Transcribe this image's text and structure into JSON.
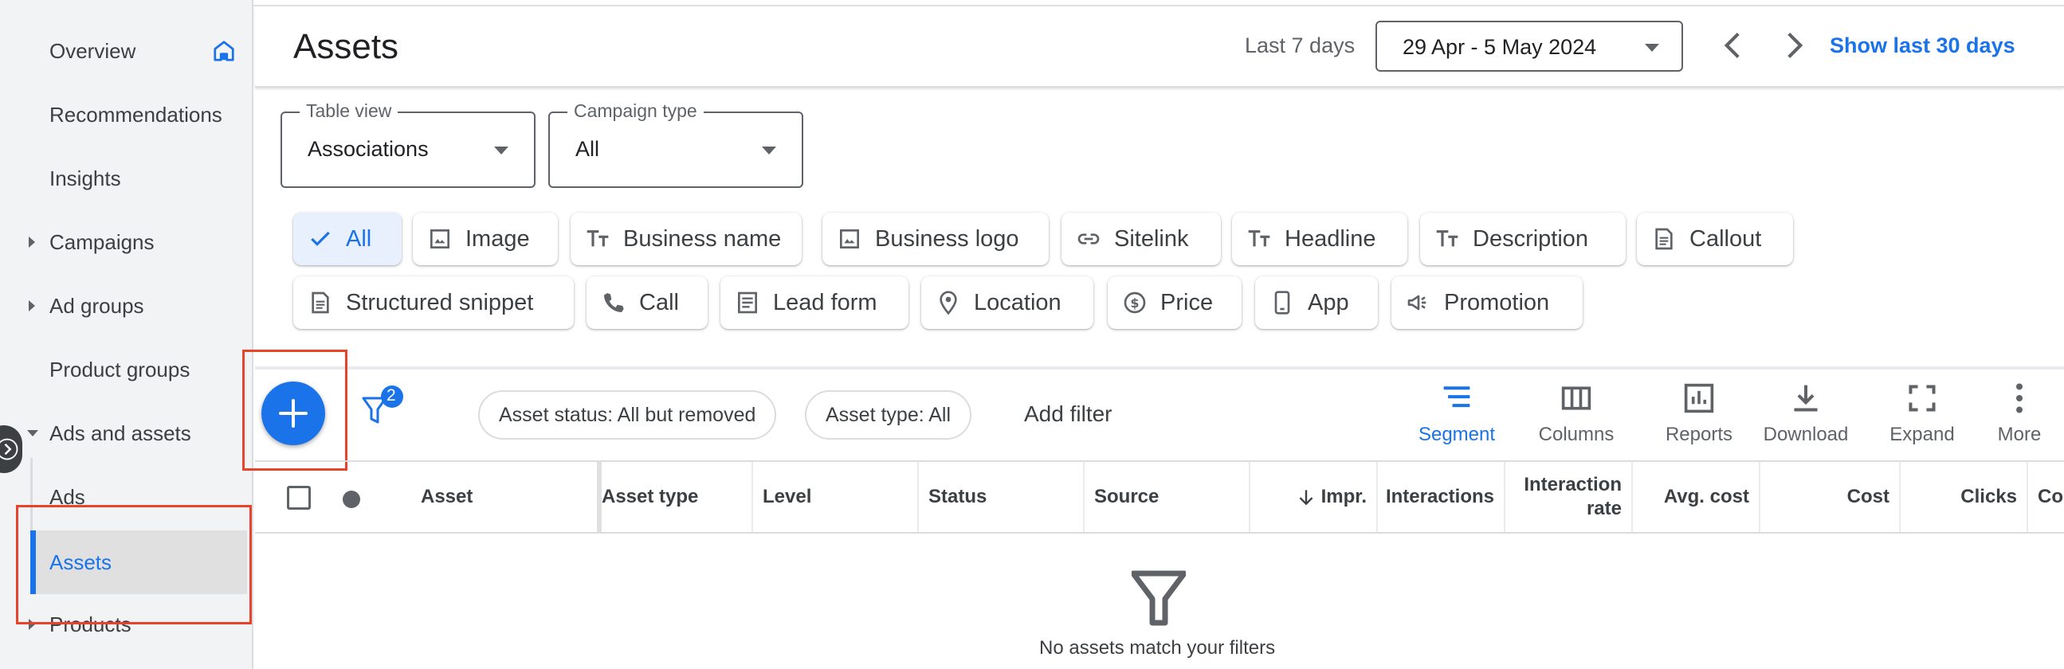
{
  "sidebar": {
    "items": [
      {
        "label": "Overview"
      },
      {
        "label": "Recommendations"
      },
      {
        "label": "Insights"
      },
      {
        "label": "Campaigns"
      },
      {
        "label": "Ad groups"
      },
      {
        "label": "Product groups"
      },
      {
        "label": "Ads and assets"
      },
      {
        "label": "Ads"
      },
      {
        "label": "Assets"
      },
      {
        "label": "Products"
      }
    ]
  },
  "header": {
    "title": "Assets",
    "date_label": "Last 7 days",
    "date_range": "29 Apr - 5 May 2024",
    "show_last_30": "Show last 30 days"
  },
  "filters": {
    "table_view": {
      "label": "Table view",
      "value": "Associations"
    },
    "campaign_type": {
      "label": "Campaign type",
      "value": "All"
    }
  },
  "chips": [
    {
      "label": "All",
      "icon": "check-icon",
      "selected": true
    },
    {
      "label": "Image",
      "icon": "image-icon"
    },
    {
      "label": "Business name",
      "icon": "text-icon"
    },
    {
      "label": "Business logo",
      "icon": "image-icon"
    },
    {
      "label": "Sitelink",
      "icon": "link-icon"
    },
    {
      "label": "Headline",
      "icon": "text-icon"
    },
    {
      "label": "Description",
      "icon": "text-icon"
    },
    {
      "label": "Callout",
      "icon": "document-icon"
    },
    {
      "label": "Structured snippet",
      "icon": "document-icon"
    },
    {
      "label": "Call",
      "icon": "phone-icon"
    },
    {
      "label": "Lead form",
      "icon": "form-icon"
    },
    {
      "label": "Location",
      "icon": "location-pin-icon"
    },
    {
      "label": "Price",
      "icon": "price-icon"
    },
    {
      "label": "App",
      "icon": "mobile-icon"
    },
    {
      "label": "Promotion",
      "icon": "megaphone-icon"
    }
  ],
  "toolbar": {
    "filter_count": "2",
    "pills": [
      "Asset status: All but removed",
      "Asset type: All"
    ],
    "add_filter": "Add filter",
    "tools": [
      {
        "label": "Segment",
        "icon": "segment-icon",
        "active": true
      },
      {
        "label": "Columns",
        "icon": "columns-icon"
      },
      {
        "label": "Reports",
        "icon": "reports-icon"
      },
      {
        "label": "Download",
        "icon": "download-icon"
      },
      {
        "label": "Expand",
        "icon": "expand-icon"
      },
      {
        "label": "More",
        "icon": "more-vert-icon"
      }
    ]
  },
  "table": {
    "columns": [
      "Asset",
      "Asset type",
      "Level",
      "Status",
      "Source",
      "Impr.",
      "Interactions",
      "Interaction rate",
      "Avg. cost",
      "Cost",
      "Clicks",
      "Co"
    ],
    "empty_message": "No assets match your filters"
  },
  "colors": {
    "accent": "#1a73e8",
    "highlight": "#e8432b",
    "sidebar_bg": "#f1f3f4"
  }
}
